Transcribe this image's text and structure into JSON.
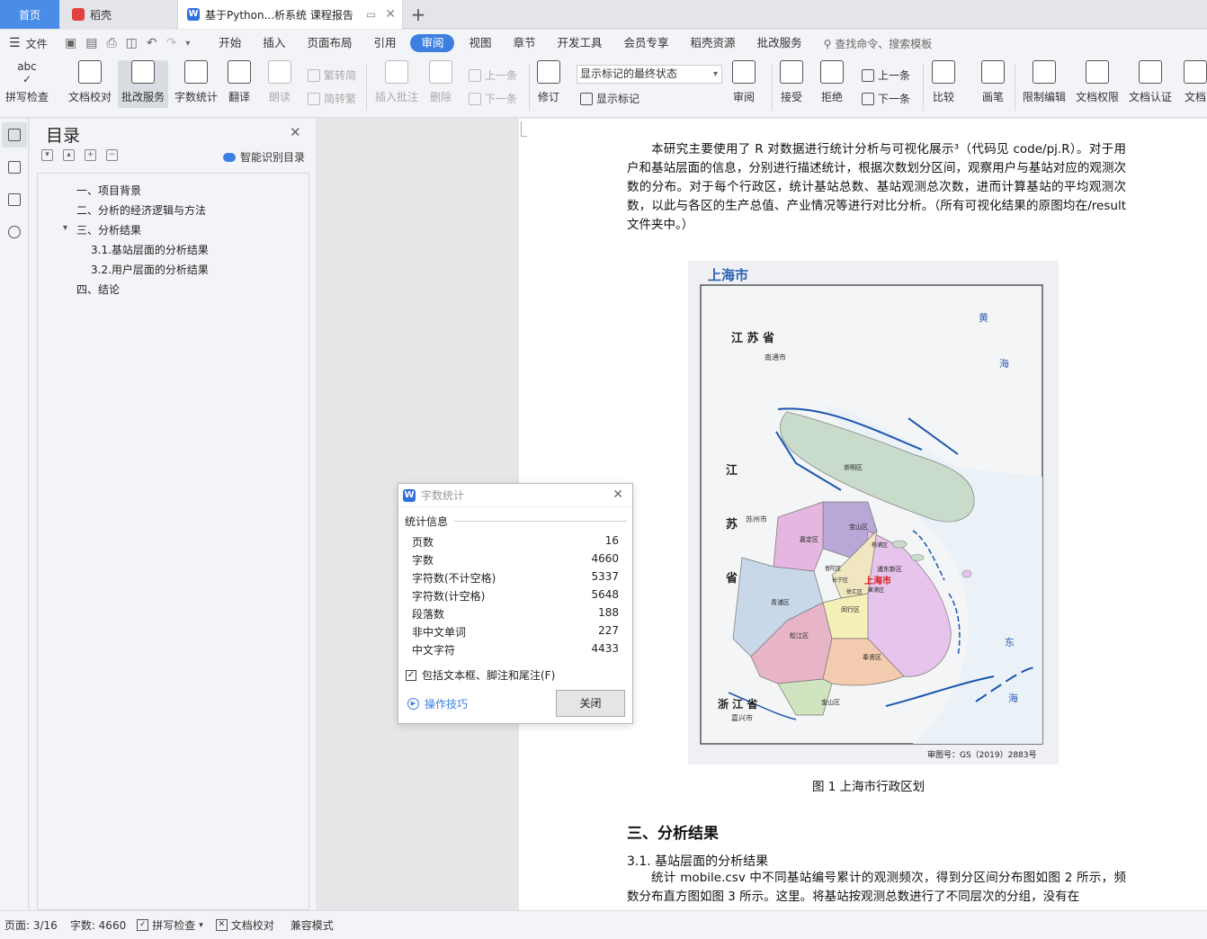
{
  "tabs": {
    "home": "首页",
    "docer": "稻壳",
    "doc": "基于Python...析系统 课程报告",
    "plus": "+"
  },
  "menubar": {
    "file": "文件",
    "tabs": [
      "开始",
      "插入",
      "页面布局",
      "引用",
      "审阅",
      "视图",
      "章节",
      "开发工具",
      "会员专享",
      "稻壳资源",
      "批改服务"
    ],
    "active_tab": "审阅",
    "search": "查找命令、搜索模板"
  },
  "ribbon": {
    "spell_check": "拼写检查",
    "doc_proof": "文档校对",
    "review_service": "批改服务",
    "word_count": "字数统计",
    "translate": "翻译",
    "read_aloud": "朗读",
    "trad_to_simp": "繁转简",
    "simp_to_trad": "简转繁",
    "insert_comment": "插入批注",
    "delete": "删除",
    "prev_comment": "上一条",
    "next_comment": "下一条",
    "track_changes": "修订",
    "markup_select": "显示标记的最终状态",
    "show_markup": "显示标记",
    "review_pane": "审阅",
    "accept": "接受",
    "reject": "拒绝",
    "prev_change": "上一条",
    "next_change": "下一条",
    "compare": "比较",
    "pen": "画笔",
    "restrict_edit": "限制编辑",
    "doc_permission": "文档权限",
    "doc_certify": "文档认证",
    "more": "文档"
  },
  "nav": {
    "title": "目录",
    "smart_toc": "智能识别目录",
    "toc": [
      "一、项目背景",
      "二、分析的经济逻辑与方法",
      "三、分析结果",
      "3.1.基站层面的分析结果",
      "3.2.用户层面的分析结果",
      "四、结论"
    ]
  },
  "doc": {
    "para1": "本研究主要使用了 R 对数据进行统计分析与可视化展示³（代码见 code/pj.R）。对于用户和基站层面的信息，分别进行描述统计，根据次数划分区间，观察用户与基站对应的观测次数的分布。对于每个行政区，统计基站总数、基站观测总次数，进而计算基站的平均观测次数，以此与各区的生产总值、产业情况等进行对比分析。（所有可视化结果的原图均在/result 文件夹中。）",
    "figure_caption": "图 1    上海市行政区划",
    "section_heading": "三、分析结果",
    "subsection_heading": "3.1.  基站层面的分析结果",
    "para2": "统计 mobile.csv 中不同基站编号累计的观测频次，得到分区间分布图如图 2 所示，频数分布直方图如图 3 所示。这里。将基站按观测总数进行了不同层次的分组，没有在"
  },
  "map": {
    "title": "上海市",
    "jiangsu": "江  苏  省",
    "nantong": "南通市",
    "huanghai": "黄",
    "hai": "海",
    "jiang": "江",
    "su": "苏",
    "sheng": "省",
    "suzhou": "苏州市",
    "chongming": "崇明区",
    "baoshan": "宝山区",
    "jiading": "嘉定区",
    "yangpu": "杨浦区",
    "pudong": "浦东新区",
    "shanghai_city": "上海市",
    "huangpu": "黄浦区",
    "putuo": "普陀区",
    "changning": "长宁区",
    "xuhui": "徐汇区",
    "qingpu": "青浦区",
    "minhang": "闵行区",
    "songjiang": "松江区",
    "fengxian": "奉贤区",
    "jinshan": "金山区",
    "zhejiang": "浙 江 省",
    "jiaxing": "嘉兴市",
    "donghai_dong": "东",
    "donghai_hai": "海",
    "approval": "审图号：GS（2019）2883号"
  },
  "dialog": {
    "title": "字数统计",
    "section": "统计信息",
    "rows": [
      {
        "label": "页数",
        "value": "16"
      },
      {
        "label": "字数",
        "value": "4660"
      },
      {
        "label": "字符数(不计空格)",
        "value": "5337"
      },
      {
        "label": "字符数(计空格)",
        "value": "5648"
      },
      {
        "label": "段落数",
        "value": "188"
      },
      {
        "label": "非中文单词",
        "value": "227"
      },
      {
        "label": "中文字符",
        "value": "4433"
      }
    ],
    "include_label": "包括文本框、脚注和尾注(F)",
    "include_checked": true,
    "tips": "操作技巧",
    "close_button": "关闭"
  },
  "statusbar": {
    "page": "页面: 3/16",
    "words": "字数: 4660",
    "spell": "拼写检查",
    "proof": "文档校对",
    "compat": "兼容模式"
  }
}
